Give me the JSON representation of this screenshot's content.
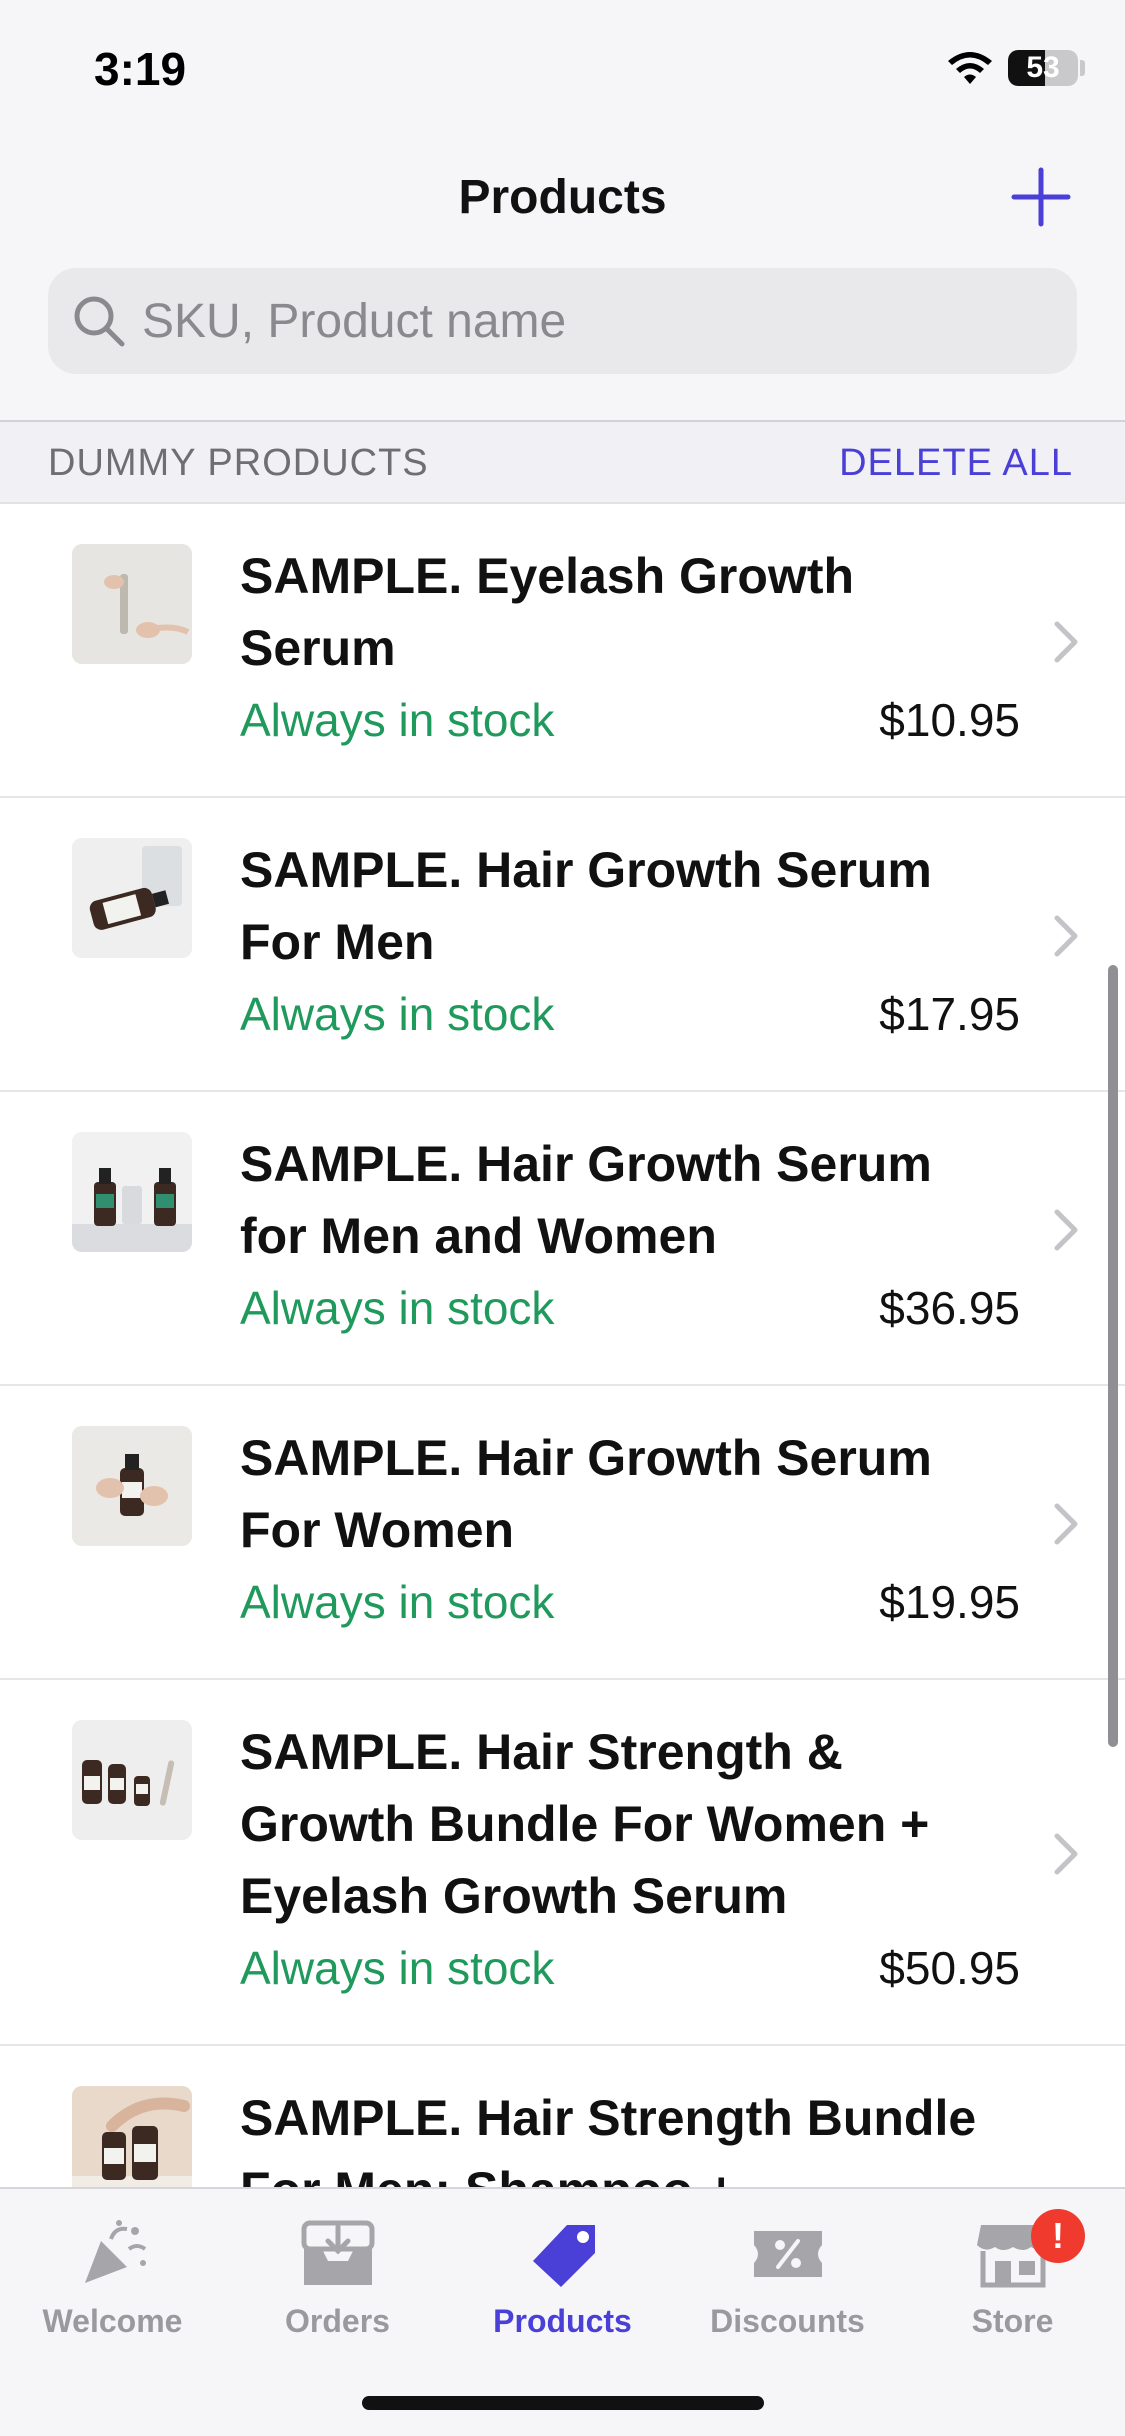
{
  "status_bar": {
    "time": "3:19",
    "battery": "53",
    "battery_fraction": 0.53
  },
  "nav": {
    "title": "Products",
    "add_icon": "plus-icon"
  },
  "search": {
    "placeholder": "SKU, Product name",
    "value": "",
    "icon": "search-icon"
  },
  "section": {
    "title": "DUMMY PRODUCTS",
    "action": "DELETE ALL"
  },
  "products": [
    {
      "name": "SAMPLE. Eyelash Growth Serum",
      "stock": "Always in stock",
      "price": "$10.95",
      "thumb": "hands-holding-serum"
    },
    {
      "name": "SAMPLE. Hair Growth Serum For Men",
      "stock": "Always in stock",
      "price": "$17.95",
      "thumb": "bottle-on-table"
    },
    {
      "name": "SAMPLE. Hair Growth Serum for Men and Women",
      "stock": "Always in stock",
      "price": "$36.95",
      "thumb": "two-bottles"
    },
    {
      "name": "SAMPLE. Hair Growth Serum For Women",
      "stock": "Always in stock",
      "price": "$19.95",
      "thumb": "hand-holding-bottle"
    },
    {
      "name": "SAMPLE. Hair Strength & Growth Bundle For Women + Eyelash Growth Serum",
      "stock": "Always in stock",
      "price": "$50.95",
      "thumb": "bundle-bottles"
    },
    {
      "name": "SAMPLE. Hair Strength Bundle For Men: Shampoo + Conditioner",
      "stock": "",
      "price": "",
      "thumb": "hand-with-bottles"
    }
  ],
  "tabs": [
    {
      "label": "Welcome",
      "icon": "party-popper-icon",
      "active": false
    },
    {
      "label": "Orders",
      "icon": "inbox-download-icon",
      "active": false
    },
    {
      "label": "Products",
      "icon": "price-tag-icon",
      "active": true
    },
    {
      "label": "Discounts",
      "icon": "percent-ticket-icon",
      "active": false
    },
    {
      "label": "Store",
      "icon": "storefront-icon",
      "active": false,
      "badge": "!"
    }
  ],
  "colors": {
    "accent": "#4a3fd6",
    "stock_green": "#1f9a5c",
    "badge_red": "#f03a2e",
    "inactive_gray": "#9a9a9e"
  }
}
